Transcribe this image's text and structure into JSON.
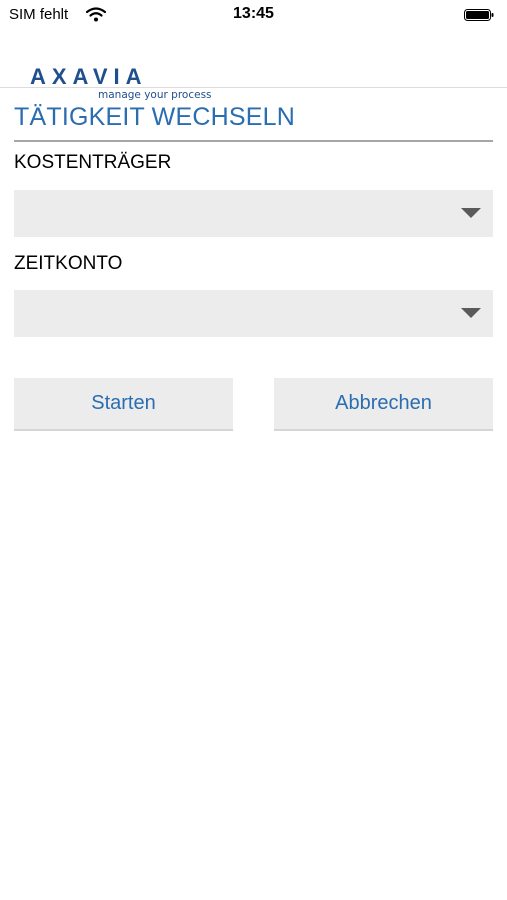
{
  "status_bar": {
    "carrier": "SIM fehlt",
    "time": "13:45",
    "icons": [
      "wifi-icon",
      "battery-icon"
    ]
  },
  "logo": {
    "name": "AXAVIA",
    "tagline": "manage your process",
    "color": "#1f4f8c"
  },
  "page": {
    "title": "TÄTIGKEIT WECHSELN",
    "accent_color": "#2a6db0"
  },
  "form": {
    "cost_center": {
      "label": "KOSTENTRÄGER",
      "value": ""
    },
    "time_account": {
      "label": "ZEITKONTO",
      "value": ""
    }
  },
  "buttons": {
    "start": "Starten",
    "cancel": "Abbrechen"
  }
}
